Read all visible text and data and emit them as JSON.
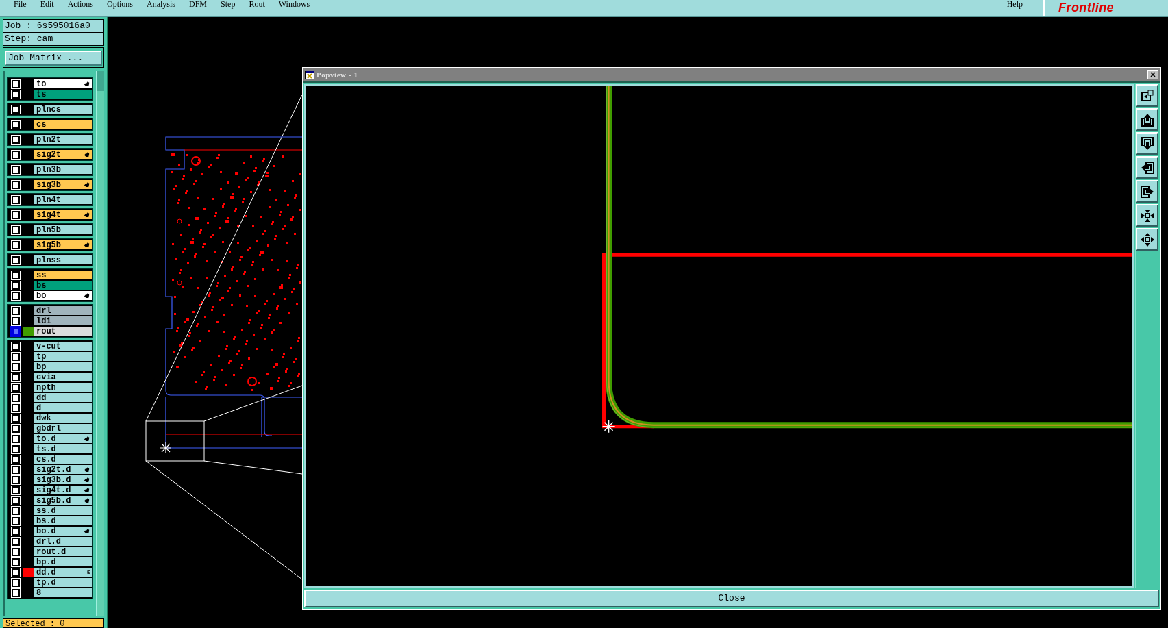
{
  "menu_bar": {
    "items": [
      "File",
      "Edit",
      "Actions",
      "Options",
      "Analysis",
      "DFM",
      "Step",
      "Rout",
      "Windows"
    ],
    "help": "Help",
    "logo": "Frontline"
  },
  "job_panel": {
    "job": "Job : 6s595016a0",
    "step": "Step: cam",
    "job_matrix_button": "Job Matrix ..."
  },
  "layer_groups": [
    {
      "layers": [
        {
          "name": "to",
          "color": "#ffffff",
          "hand_mark": true,
          "selected": false
        },
        {
          "name": "ts",
          "color": "#00a07c",
          "hand_mark": false,
          "selected": false
        }
      ]
    },
    {
      "layers": [
        {
          "name": "plncs",
          "color": "#a0dcdc",
          "hand_mark": false,
          "selected": false
        }
      ]
    },
    {
      "layers": [
        {
          "name": "cs",
          "color": "#ffc850",
          "hand_mark": false,
          "selected": false
        }
      ]
    },
    {
      "layers": [
        {
          "name": "pln2t",
          "color": "#a0dcdc",
          "hand_mark": false,
          "selected": false
        }
      ]
    },
    {
      "layers": [
        {
          "name": "sig2t",
          "color": "#ffc850",
          "hand_mark": true,
          "selected": false
        }
      ]
    },
    {
      "layers": [
        {
          "name": "pln3b",
          "color": "#a0dcdc",
          "hand_mark": false,
          "selected": false
        }
      ]
    },
    {
      "layers": [
        {
          "name": "sig3b",
          "color": "#ffc850",
          "hand_mark": true,
          "selected": false
        }
      ]
    },
    {
      "layers": [
        {
          "name": "pln4t",
          "color": "#a0dcdc",
          "hand_mark": false,
          "selected": false
        }
      ]
    },
    {
      "layers": [
        {
          "name": "sig4t",
          "color": "#ffc850",
          "hand_mark": true,
          "selected": false
        }
      ]
    },
    {
      "layers": [
        {
          "name": "pln5b",
          "color": "#a0dcdc",
          "hand_mark": false,
          "selected": false
        }
      ]
    },
    {
      "layers": [
        {
          "name": "sig5b",
          "color": "#ffc850",
          "hand_mark": true,
          "selected": false
        }
      ]
    },
    {
      "layers": [
        {
          "name": "plnss",
          "color": "#a0dcdc",
          "hand_mark": false,
          "selected": false
        }
      ]
    },
    {
      "layers": [
        {
          "name": "ss",
          "color": "#ffc850",
          "hand_mark": false,
          "selected": false
        },
        {
          "name": "bs",
          "color": "#00a07c",
          "hand_mark": false,
          "selected": false
        },
        {
          "name": "bo",
          "color": "#ffffff",
          "hand_mark": true,
          "selected": false
        }
      ]
    },
    {
      "layers": [
        {
          "name": "drl",
          "color": "#a0b4bc",
          "hand_mark": false,
          "selected": false
        },
        {
          "name": "ldi",
          "color": "#a0b4bc",
          "hand_mark": false,
          "selected": false
        },
        {
          "name": "rout",
          "color": "#dcdcdc",
          "swatch": {
            "color": "#409c00"
          },
          "hand_mark": false,
          "selected": true
        }
      ]
    },
    {
      "layers": [
        {
          "name": "v-cut",
          "color": "#a0dcdc",
          "hand_mark": false,
          "selected": false
        },
        {
          "name": "tp",
          "color": "#a0dcdc",
          "hand_mark": false,
          "selected": false
        },
        {
          "name": "bp",
          "color": "#a0dcdc",
          "hand_mark": false,
          "selected": false
        },
        {
          "name": "cvia",
          "color": "#a0dcdc",
          "hand_mark": false,
          "selected": false
        },
        {
          "name": "npth",
          "color": "#a0dcdc",
          "hand_mark": false,
          "selected": false
        },
        {
          "name": "dd",
          "color": "#a0dcdc",
          "hand_mark": false,
          "selected": false
        },
        {
          "name": "d",
          "color": "#a0dcdc",
          "hand_mark": false,
          "selected": false
        },
        {
          "name": "dwk",
          "color": "#a0dcdc",
          "hand_mark": false,
          "selected": false
        },
        {
          "name": "gbdrl",
          "color": "#a0dcdc",
          "hand_mark": false,
          "selected": false
        },
        {
          "name": "to.d",
          "color": "#a0dcdc",
          "hand_mark": true,
          "selected": false
        },
        {
          "name": "ts.d",
          "color": "#a0dcdc",
          "hand_mark": false,
          "selected": false
        },
        {
          "name": "cs.d",
          "color": "#a0dcdc",
          "hand_mark": false,
          "selected": false
        },
        {
          "name": "sig2t.d",
          "color": "#a0dcdc",
          "hand_mark": true,
          "selected": false
        },
        {
          "name": "sig3b.d",
          "color": "#a0dcdc",
          "hand_mark": true,
          "selected": false
        },
        {
          "name": "sig4t.d",
          "color": "#a0dcdc",
          "hand_mark": true,
          "selected": false
        },
        {
          "name": "sig5b.d",
          "color": "#a0dcdc",
          "hand_mark": true,
          "selected": false
        },
        {
          "name": "ss.d",
          "color": "#a0dcdc",
          "hand_mark": false,
          "selected": false
        },
        {
          "name": "bs.d",
          "color": "#a0dcdc",
          "hand_mark": false,
          "selected": false
        },
        {
          "name": "bo.d",
          "color": "#a0dcdc",
          "hand_mark": true,
          "selected": false
        },
        {
          "name": "drl.d",
          "color": "#a0dcdc",
          "hand_mark": false,
          "selected": false
        },
        {
          "name": "rout.d",
          "color": "#a0dcdc",
          "hand_mark": false,
          "selected": false
        },
        {
          "name": "bp.d",
          "color": "#a0dcdc",
          "hand_mark": false,
          "selected": false
        },
        {
          "name": "dd.d",
          "color": "#a0dcdc",
          "swatch": {
            "color": "#ff0000"
          },
          "badge": "⊞",
          "hand_mark": false,
          "selected": false
        },
        {
          "name": "tp.d",
          "color": "#a0dcdc",
          "hand_mark": false,
          "selected": false
        },
        {
          "name": "8",
          "color": "#a0dcdc",
          "hand_mark": false,
          "selected": false
        }
      ]
    }
  ],
  "selected_bar": "Selected : 0",
  "popview": {
    "title": "Popview - 1",
    "close_button": "Close"
  }
}
